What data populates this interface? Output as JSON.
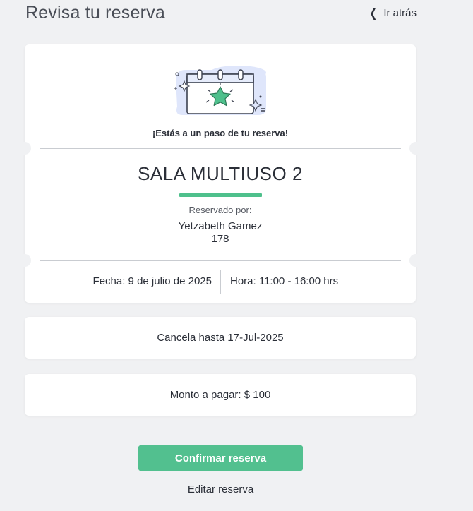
{
  "header": {
    "title": "Revisa tu reserva",
    "back_label": "Ir atrás"
  },
  "ticket": {
    "tagline": "¡Estás a un paso de tu reserva!",
    "room_name": "SALA MULTIUSO 2",
    "reserved_label": "Reservado por:",
    "reserved_name": "Yetzabeth Gamez",
    "reserved_id": "178",
    "date": "Fecha: 9 de julio de 2025",
    "time": "Hora: 11:00 - 16:00 hrs"
  },
  "cancel_card": {
    "text": "Cancela hasta 17-Jul-2025"
  },
  "amount_card": {
    "text": "Monto a pagar: $ 100"
  },
  "actions": {
    "confirm_label": "Confirmar reserva",
    "edit_label": "Editar reserva"
  },
  "colors": {
    "accent": "#52c08f",
    "background": "#f0f1f3",
    "card": "#ffffff",
    "text": "#2b2f38",
    "illustration_blue": "#dfe6fb",
    "star_green": "#4ec08c"
  },
  "icons": {
    "back": "chevron-left-icon",
    "illustration": "calendar-star-icon"
  }
}
